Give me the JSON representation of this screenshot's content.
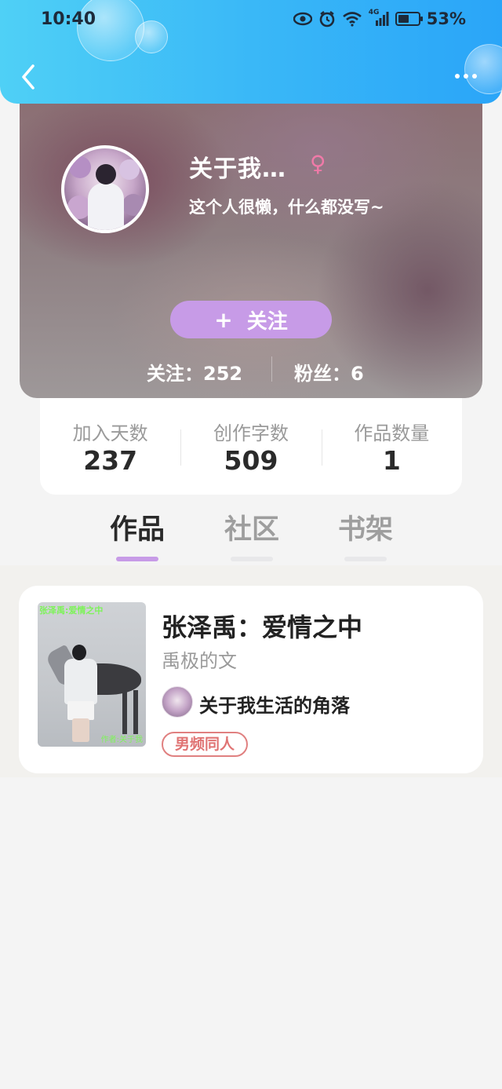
{
  "status_bar": {
    "time": "10:40",
    "signal_label": "4G",
    "battery_percent_text": "53%",
    "battery_level": 0.53
  },
  "header": {
    "back_icon": "chevron-left-icon",
    "more_icon": "more-horizontal-icon",
    "background_color": "#3ab8f7"
  },
  "profile": {
    "nickname": "关于我…",
    "gender_symbol": "♀",
    "signature": "这个人很懒，什么都没写~",
    "follow_button": {
      "plus": "+",
      "label": "关注",
      "color": "#c79be7"
    },
    "following": "关注：252",
    "fans": "粉丝：6"
  },
  "stats": [
    {
      "label": "加入天数",
      "value": "237"
    },
    {
      "label": "创作字数",
      "value": "509"
    },
    {
      "label": "作品数量",
      "value": "1"
    }
  ],
  "tabs": [
    {
      "label": "作品",
      "active": true
    },
    {
      "label": "社区",
      "active": false
    },
    {
      "label": "书架",
      "active": false
    }
  ],
  "works": [
    {
      "cover_title": "张泽禹:爱情之中",
      "cover_author": "作者:关于我",
      "title": "张泽禹：爱情之中",
      "subtitle": "禹极的文",
      "author": "关于我生活的角落",
      "tag": "男频同人",
      "tag_color": "#e07474"
    }
  ]
}
